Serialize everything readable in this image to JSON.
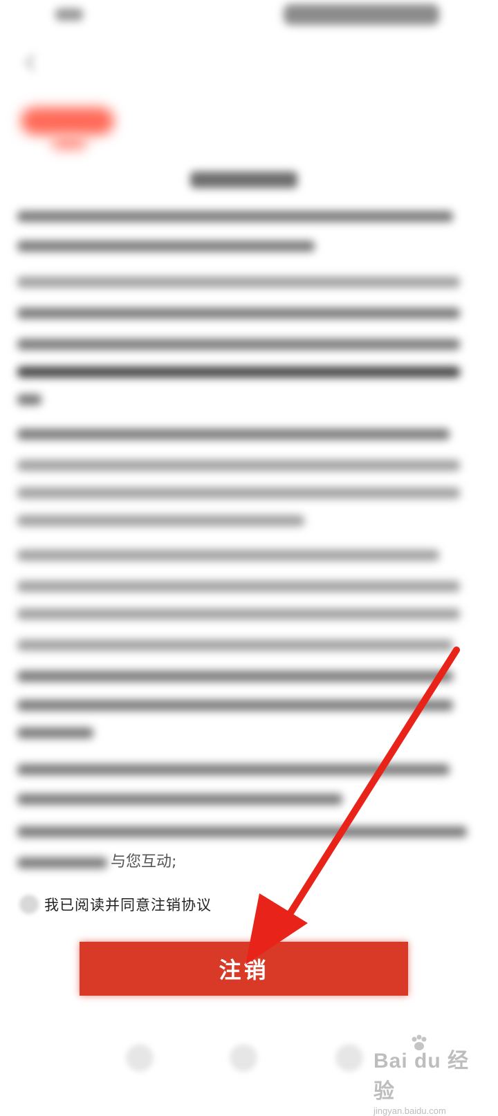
{
  "agreement": {
    "tail_text": "与您互动;",
    "checkbox_label": "我已阅读并同意注销协议"
  },
  "actions": {
    "cancel_label": "注销"
  },
  "watermark": {
    "brand": "Bai du 经验",
    "url": "jingyan.baidu.com"
  },
  "colors": {
    "primary_button": "#d93a28",
    "annotation_arrow": "#e8231a"
  },
  "icons": {
    "back": "chevron-left-icon",
    "annotation": "arrow-icon"
  }
}
